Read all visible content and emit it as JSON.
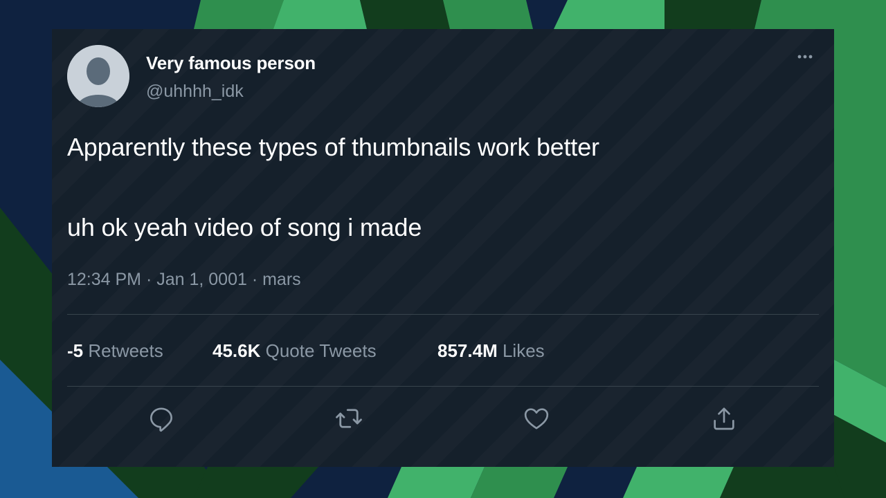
{
  "tweet": {
    "display_name": "Very famous person",
    "handle": "@uhhhh_idk",
    "text_lines": [
      "Apparently these types of thumbnails work better",
      "uh ok yeah video of song i made"
    ],
    "meta": "12:34 PM · Jan 1, 0001 · mars",
    "stats": {
      "retweets": {
        "count": "-5",
        "label": "Retweets"
      },
      "quote_tweets": {
        "count": "45.6K",
        "label": "Quote Tweets"
      },
      "likes": {
        "count": "857.4M",
        "label": "Likes"
      }
    },
    "actions": [
      "reply-icon",
      "retweet-icon",
      "like-icon",
      "share-icon"
    ],
    "more_icon": "more-options-icon"
  },
  "colors": {
    "card_bg": "#15202b",
    "text_primary": "#ffffff",
    "text_secondary": "#8b98a5",
    "divider": "#38444d",
    "bg_dark": "#0f2240",
    "bg_green": "#2f8f4e",
    "bg_light_green": "#41b26b",
    "bg_blue": "#1a5a93"
  }
}
